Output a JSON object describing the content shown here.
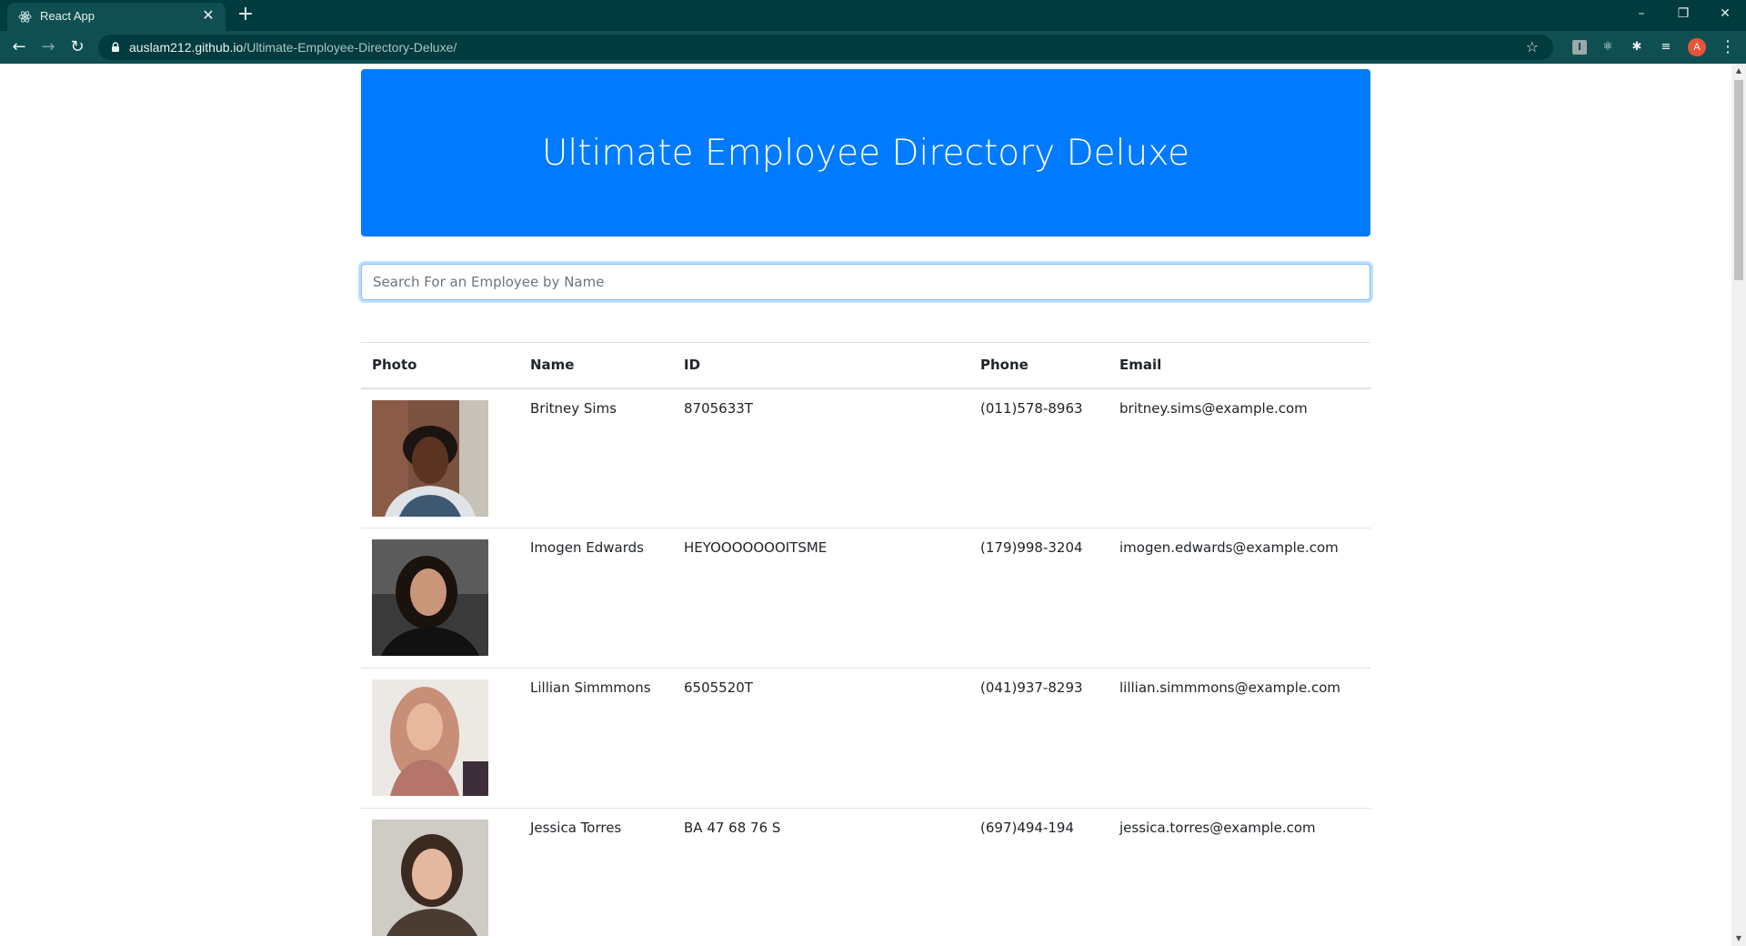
{
  "browser": {
    "tab_title": "React App",
    "url_host": "auslam212.github.io",
    "url_path": "/Ultimate-Employee-Directory-Deluxe/",
    "profile_initial": "A",
    "window_controls": [
      "–",
      "❐",
      "✕"
    ]
  },
  "header": {
    "title": "Ultimate Employee Directory Deluxe",
    "color": "#007bff"
  },
  "search": {
    "placeholder": "Search For an Employee by Name",
    "value": ""
  },
  "table": {
    "columns": [
      "Photo",
      "Name",
      "ID",
      "Phone",
      "Email"
    ],
    "rows": [
      {
        "name": "Britney Sims",
        "id": "8705633T",
        "phone": "(011)578-8963",
        "email": "britney.sims@example.com",
        "photo_bg": "#6b4a3a"
      },
      {
        "name": "Imogen Edwards",
        "id": "HEYOOOOOOOITSME",
        "phone": "(179)998-3204",
        "email": "imogen.edwards@example.com",
        "photo_bg": "#4a4a4a"
      },
      {
        "name": "Lillian Simmmons",
        "id": "6505520T",
        "phone": "(041)937-8293",
        "email": "lillian.simmmons@example.com",
        "photo_bg": "#d9b8a8"
      },
      {
        "name": "Jessica Torres",
        "id": "BA 47 68 76 S",
        "phone": "(697)494-194",
        "email": "jessica.torres@example.com",
        "photo_bg": "#b9b1a6"
      }
    ]
  }
}
